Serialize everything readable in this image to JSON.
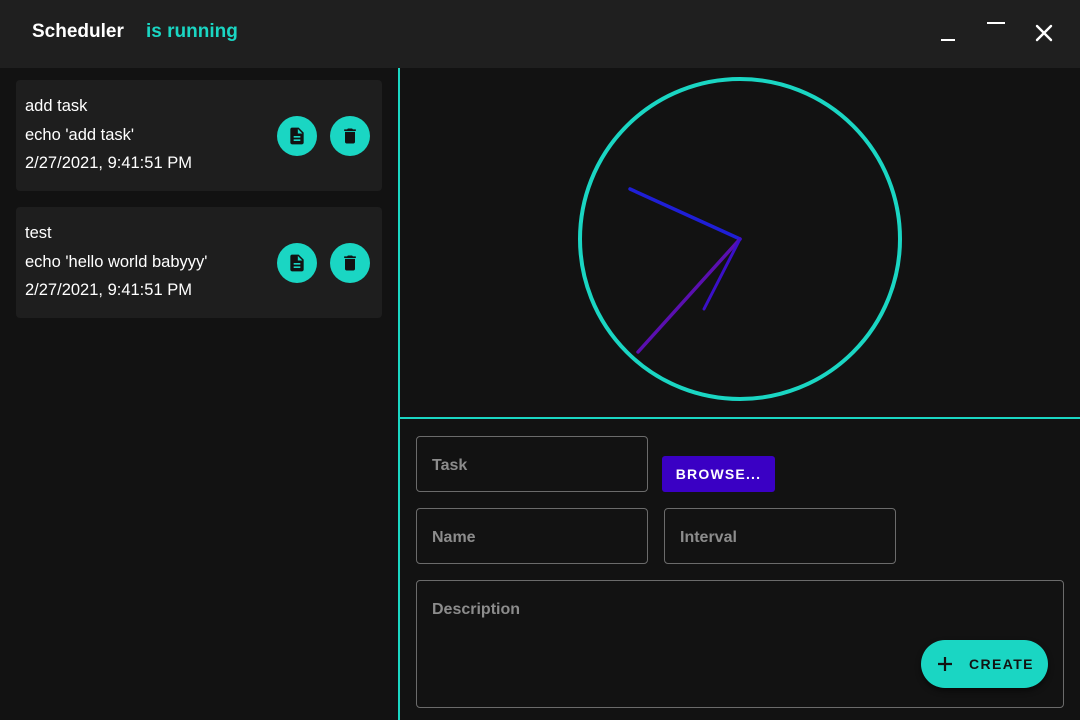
{
  "titlebar": {
    "app_name": "Scheduler",
    "status": "is running",
    "controls": {
      "minimize": "minimize-icon",
      "maximize": "maximize-icon",
      "close": "close-icon"
    }
  },
  "tasks": [
    {
      "name": "add task",
      "command": "echo 'add task'",
      "timestamp": "2/27/2021, 9:41:51 PM"
    },
    {
      "name": "test",
      "command": "echo 'hello world babyyy'",
      "timestamp": "2/27/2021, 9:41:51 PM"
    }
  ],
  "clock": {
    "ring_color": "#1ad6c3",
    "hour_hand_color": "#1f1fd6",
    "minute_hand_color": "#5a0fb0",
    "second_hand_color": "#3a10c8"
  },
  "form": {
    "task_placeholder": "Task",
    "browse_label": "BROWSE...",
    "name_placeholder": "Name",
    "interval_placeholder": "Interval",
    "description_placeholder": "Description",
    "create_label": "CREATE"
  },
  "colors": {
    "accent": "#1ad6c3",
    "browse": "#3a00c4",
    "background": "#121212",
    "titlebar": "#1f1f1f",
    "card": "#1e1e1e"
  }
}
